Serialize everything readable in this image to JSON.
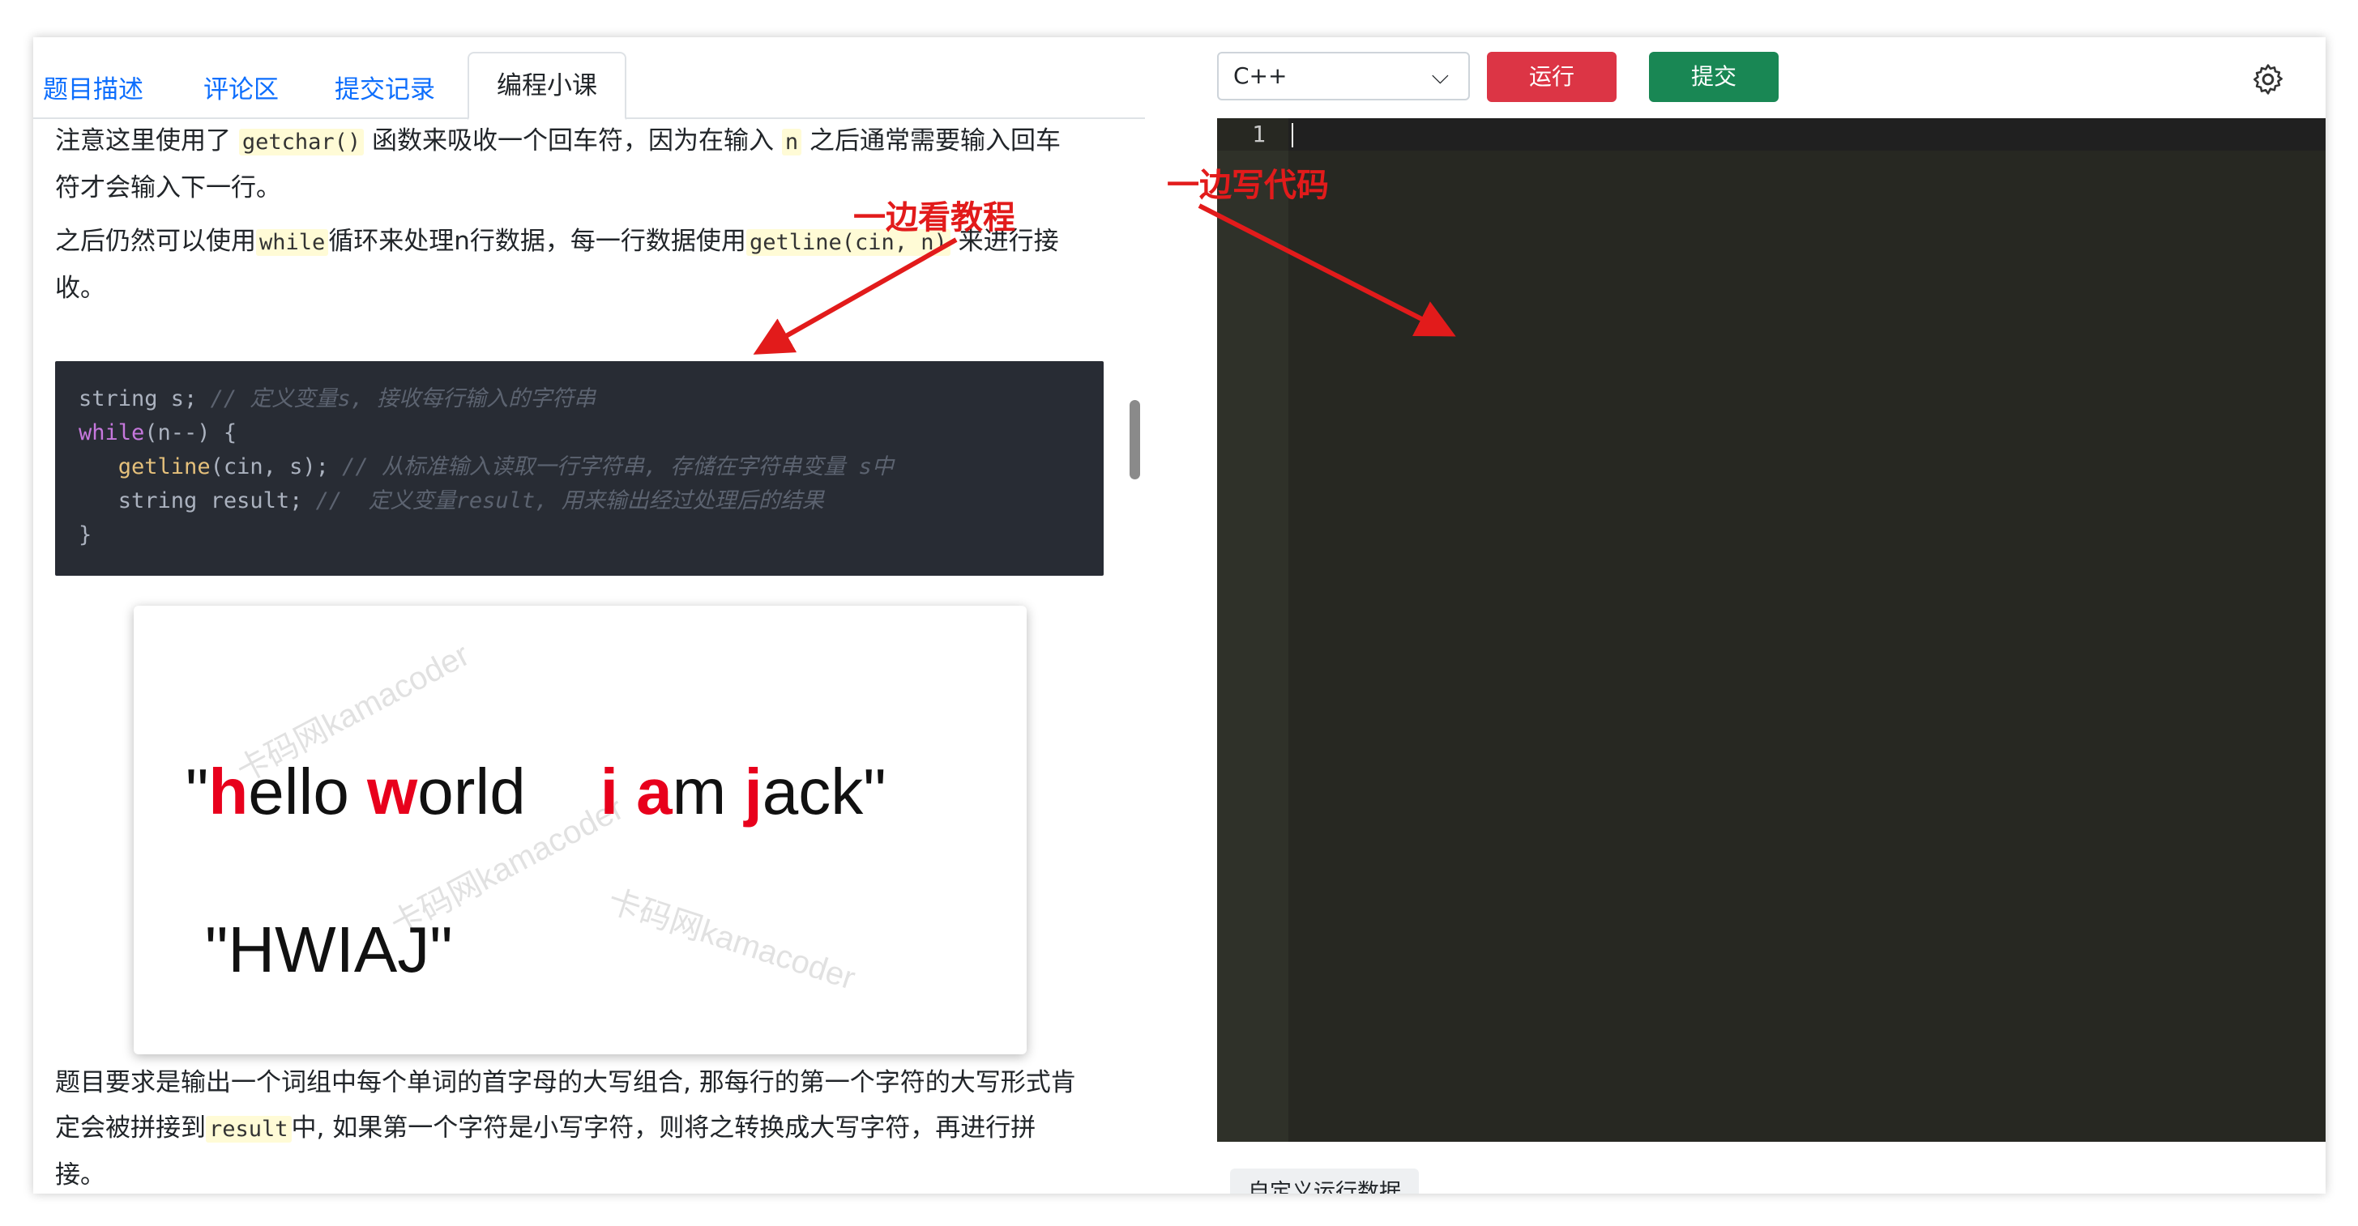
{
  "tabs": [
    "题目描述",
    "评论区",
    "提交记录",
    "编程小课"
  ],
  "content": {
    "p1": [
      "注意这里使用了 ",
      "getchar()",
      " 函数来吸收一个回车符，因为在输入 ",
      "n",
      " 之后通常需要输入回车",
      "符才会输入下一行。"
    ],
    "p2": [
      "之后仍然可以使用",
      "while",
      "循环来处理n行数据，每一行数据使用",
      "getline(cin, n)",
      " 来进行接",
      "收。"
    ],
    "code": {
      "l1a": "string s; ",
      "l1c": "// 定义变量s, 接收每行输入的字符串",
      "l2kw": "while",
      "l2r": "(n--) {",
      "l3fn": "getline",
      "l3r": "(cin, s); ",
      "l3c": "// 从标准输入读取一行字符串, 存储在字符串变量 s中",
      "l4a": "string result; ",
      "l4c": "//  定义变量result, 用来输出经过处理后的结果",
      "l5": "}"
    },
    "image": {
      "q1": "\"",
      "hi1": "h",
      "w1": "ello ",
      "hi2": "w",
      "w2": "orld",
      "hi3": "i",
      "hi4": "a",
      "w4": "m ",
      "hi5": "j",
      "w5": "ack\"",
      "result": "\"HWIAJ\"",
      "watermark": "卡码网kamacoder"
    },
    "p3": [
      "题目要求是输出一个词组中每个单词的首字母的大写组合, 那每行的第一个字符的大写形式肯",
      "定会被拼接到",
      "result",
      "中, 如果第一个字符是小写字符，则将之转换成大写字符，再进行拼",
      "接。"
    ]
  },
  "editor": {
    "language": "C++",
    "run_label": "运行",
    "submit_label": "提交",
    "line_number": "1",
    "custom_data_label": "自定义运行数据"
  },
  "annotations": {
    "left": "一边看教程",
    "right": "一边写代码",
    "color": "#e21b1b"
  },
  "icons": {
    "settings": "gear-icon",
    "dropdown": "chevron-down-icon"
  }
}
